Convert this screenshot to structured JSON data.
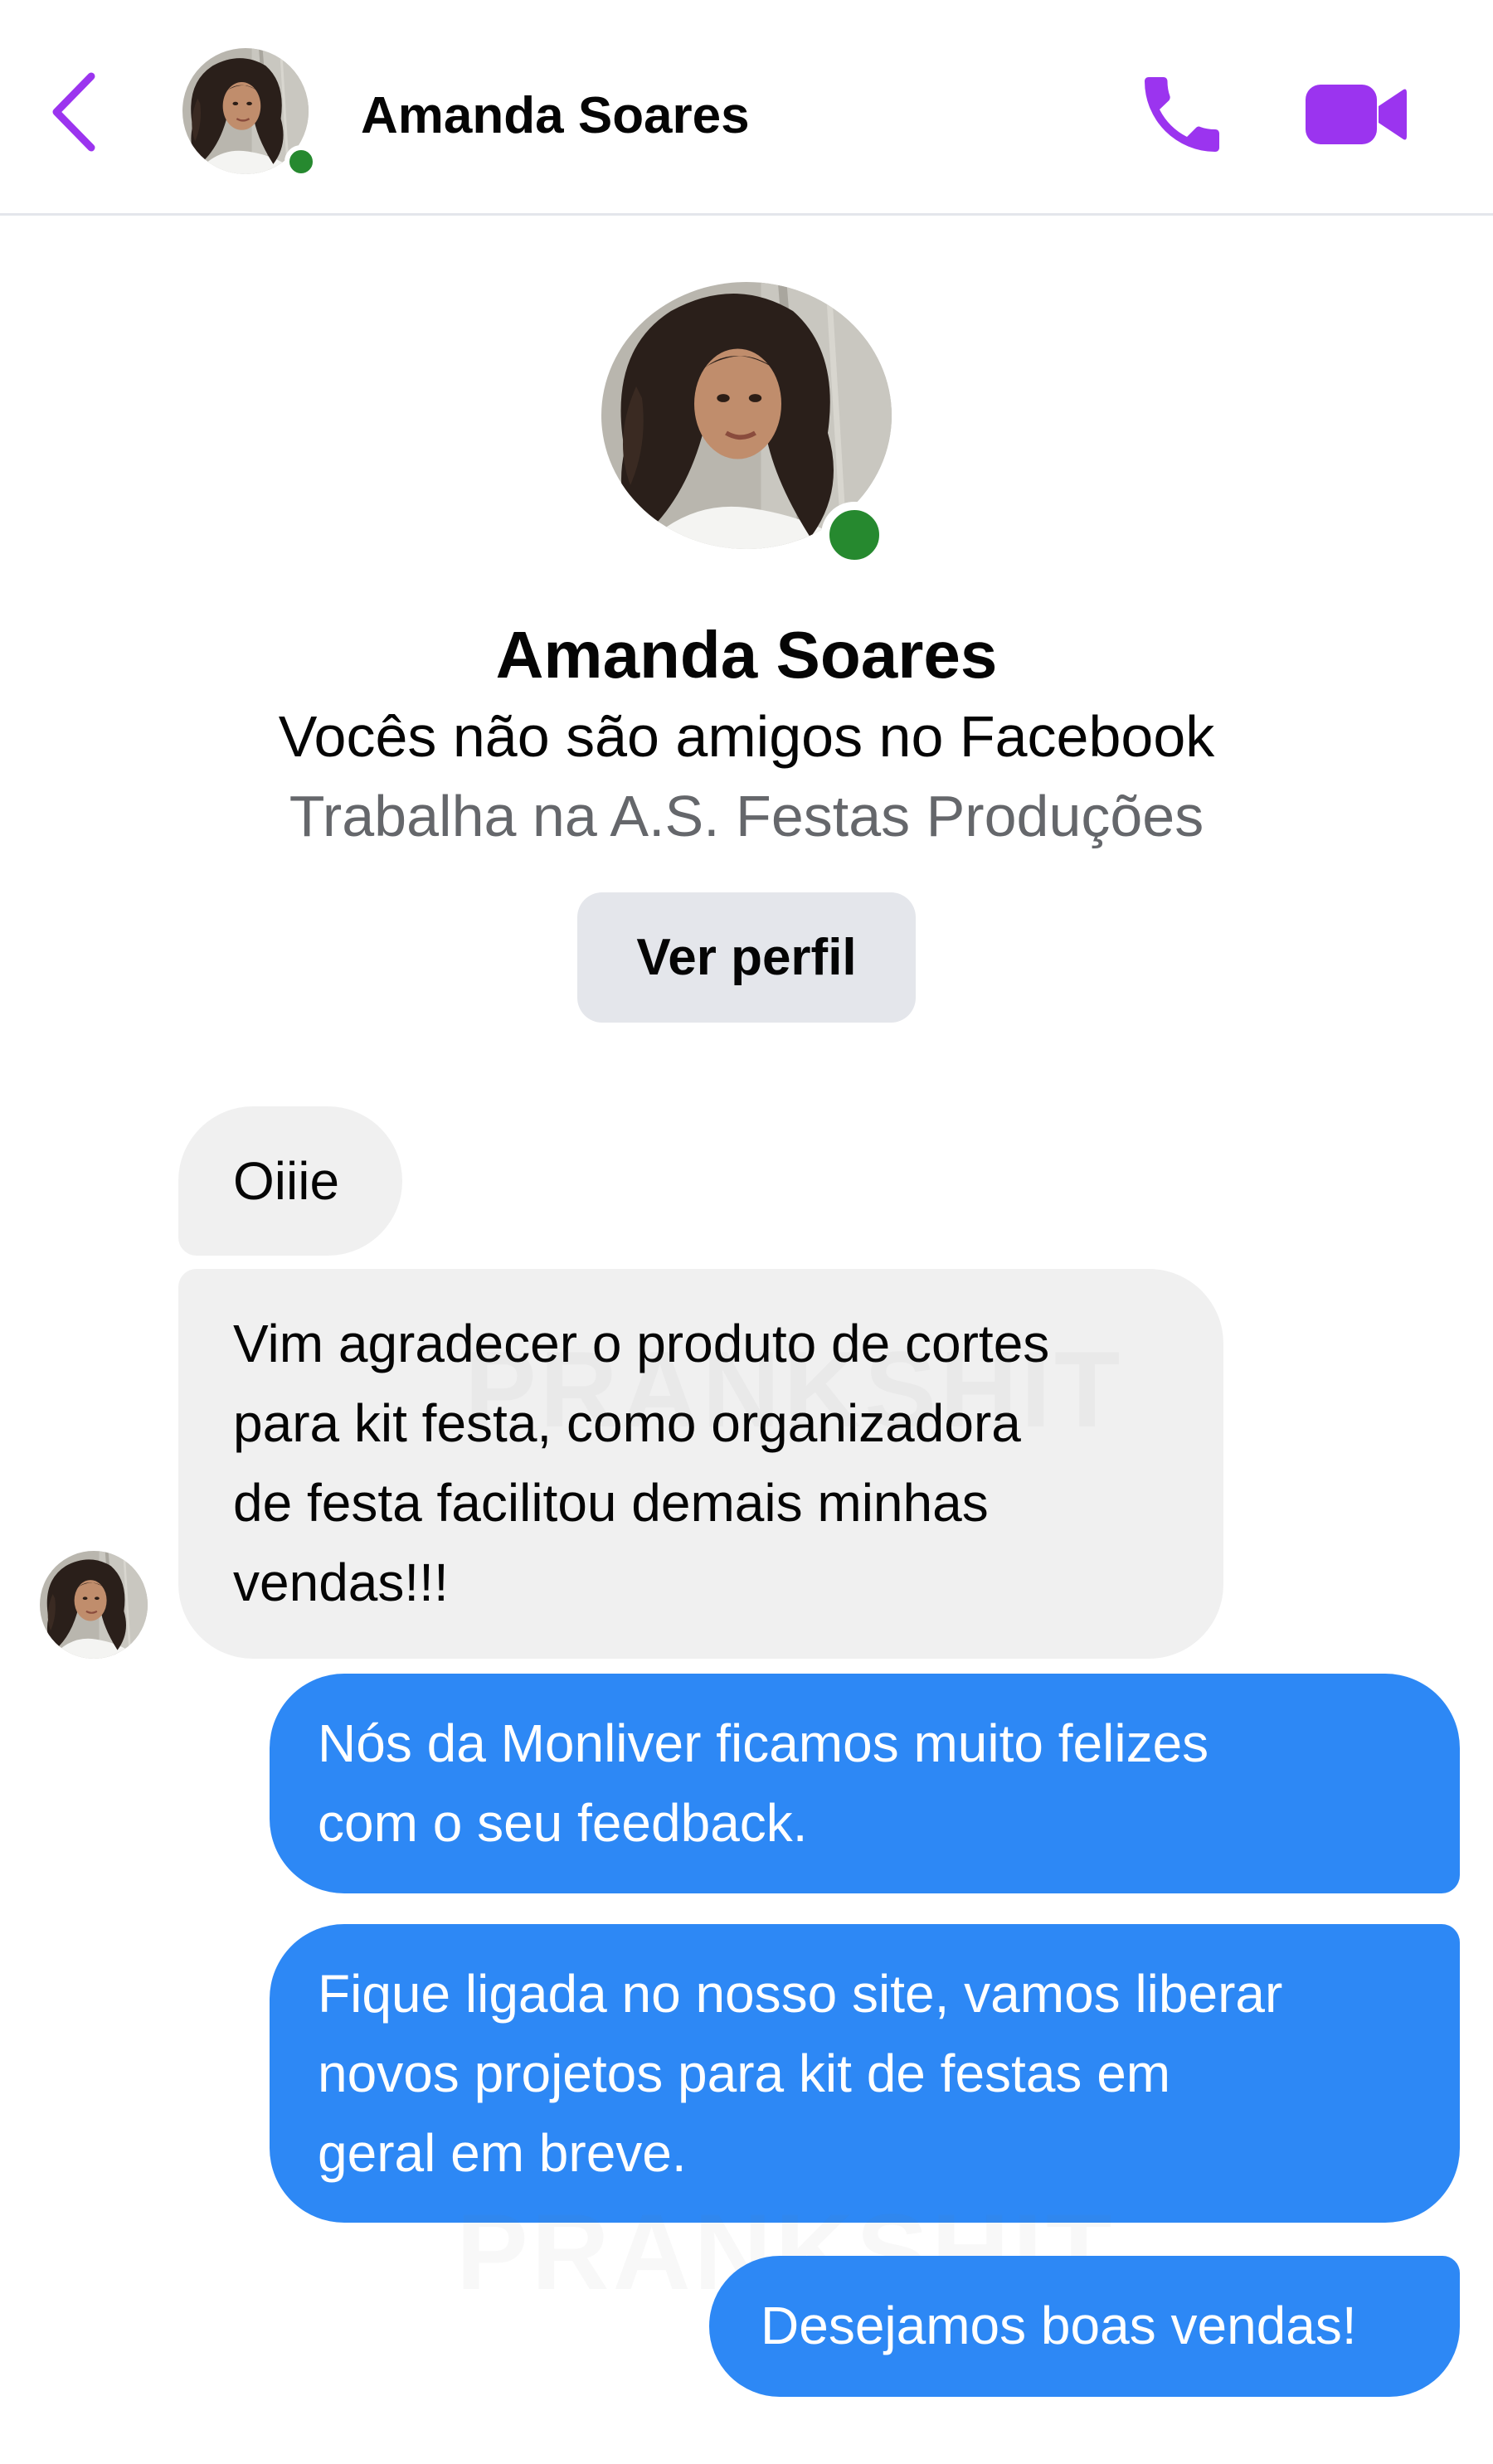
{
  "header": {
    "contact_name": "Amanda Soares",
    "accent_color": "#9b34ef",
    "icons": [
      "chevron-left-icon",
      "phone-icon",
      "video-camera-icon"
    ]
  },
  "profile": {
    "name": "Amanda Soares",
    "relationship": "Vocês não são amigos no Facebook",
    "work": "Trabalha na A.S. Festas Produções",
    "view_profile_label": "Ver perfil",
    "online_color": "#26892f"
  },
  "messages": [
    {
      "sender": "contact",
      "text": "Oiiie"
    },
    {
      "sender": "contact",
      "lines": [
        "Vim agradecer o produto de cortes",
        "para kit festa, como organizadora",
        "de festa facilitou demais minhas",
        "vendas!!!"
      ]
    },
    {
      "sender": "me",
      "lines": [
        "Nós da Monliver ficamos muito felizes",
        "com o seu feedback."
      ]
    },
    {
      "sender": "me",
      "lines": [
        "Fique ligada no nosso site, vamos liberar",
        "novos projetos para kit de festas em",
        "geral em breve."
      ]
    },
    {
      "sender": "me",
      "text": "Desejamos boas vendas!"
    }
  ],
  "bubble_colors": {
    "incoming": "#f0f0f0",
    "outgoing": "#2d88f5"
  },
  "watermark": "PRANKSHIT"
}
